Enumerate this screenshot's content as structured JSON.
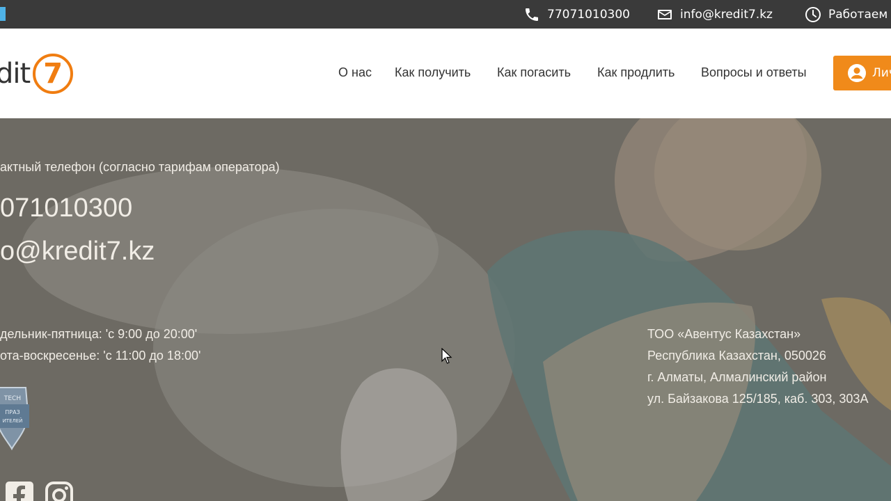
{
  "topbar": {
    "phone": "77071010300",
    "email": "info@kredit7.kz",
    "hours_label": "Работаем",
    "icons": [
      "phone-icon",
      "mail-icon",
      "clock-icon"
    ]
  },
  "header": {
    "logo_text": "dit",
    "logo_digit": "7",
    "nav": [
      "О нас",
      "Как получить",
      "Как погасить",
      "Как продлить",
      "Вопросы и ответы"
    ],
    "cabinet_label": "Лич"
  },
  "hero": {
    "contact_phone_note": "актный телефон (согласно тарифам оператора)",
    "phone": "071010300",
    "email": "o@kredit7.kz",
    "schedule_weekdays": "дельник-пятница: 'с 9:00 до 20:00'",
    "schedule_weekend": "ота-воскресенье: 'с 11:00 до 18:00'",
    "company": "ТОО «Авентус Казахстан»",
    "address_1": "Республика Казахстан, 050026",
    "address_2": "г. Алматы, Алмалинский район",
    "address_3": "ул. Байзакова 125/185, каб. 303, 303А",
    "badge_lines": [
      "TECH",
      "ПРАЗ",
      "ИТЕЛЕЙ"
    ]
  },
  "colors": {
    "accent": "#f08a1a",
    "topbar_bg": "#3a3a3a",
    "header_bg": "#ffffff"
  }
}
